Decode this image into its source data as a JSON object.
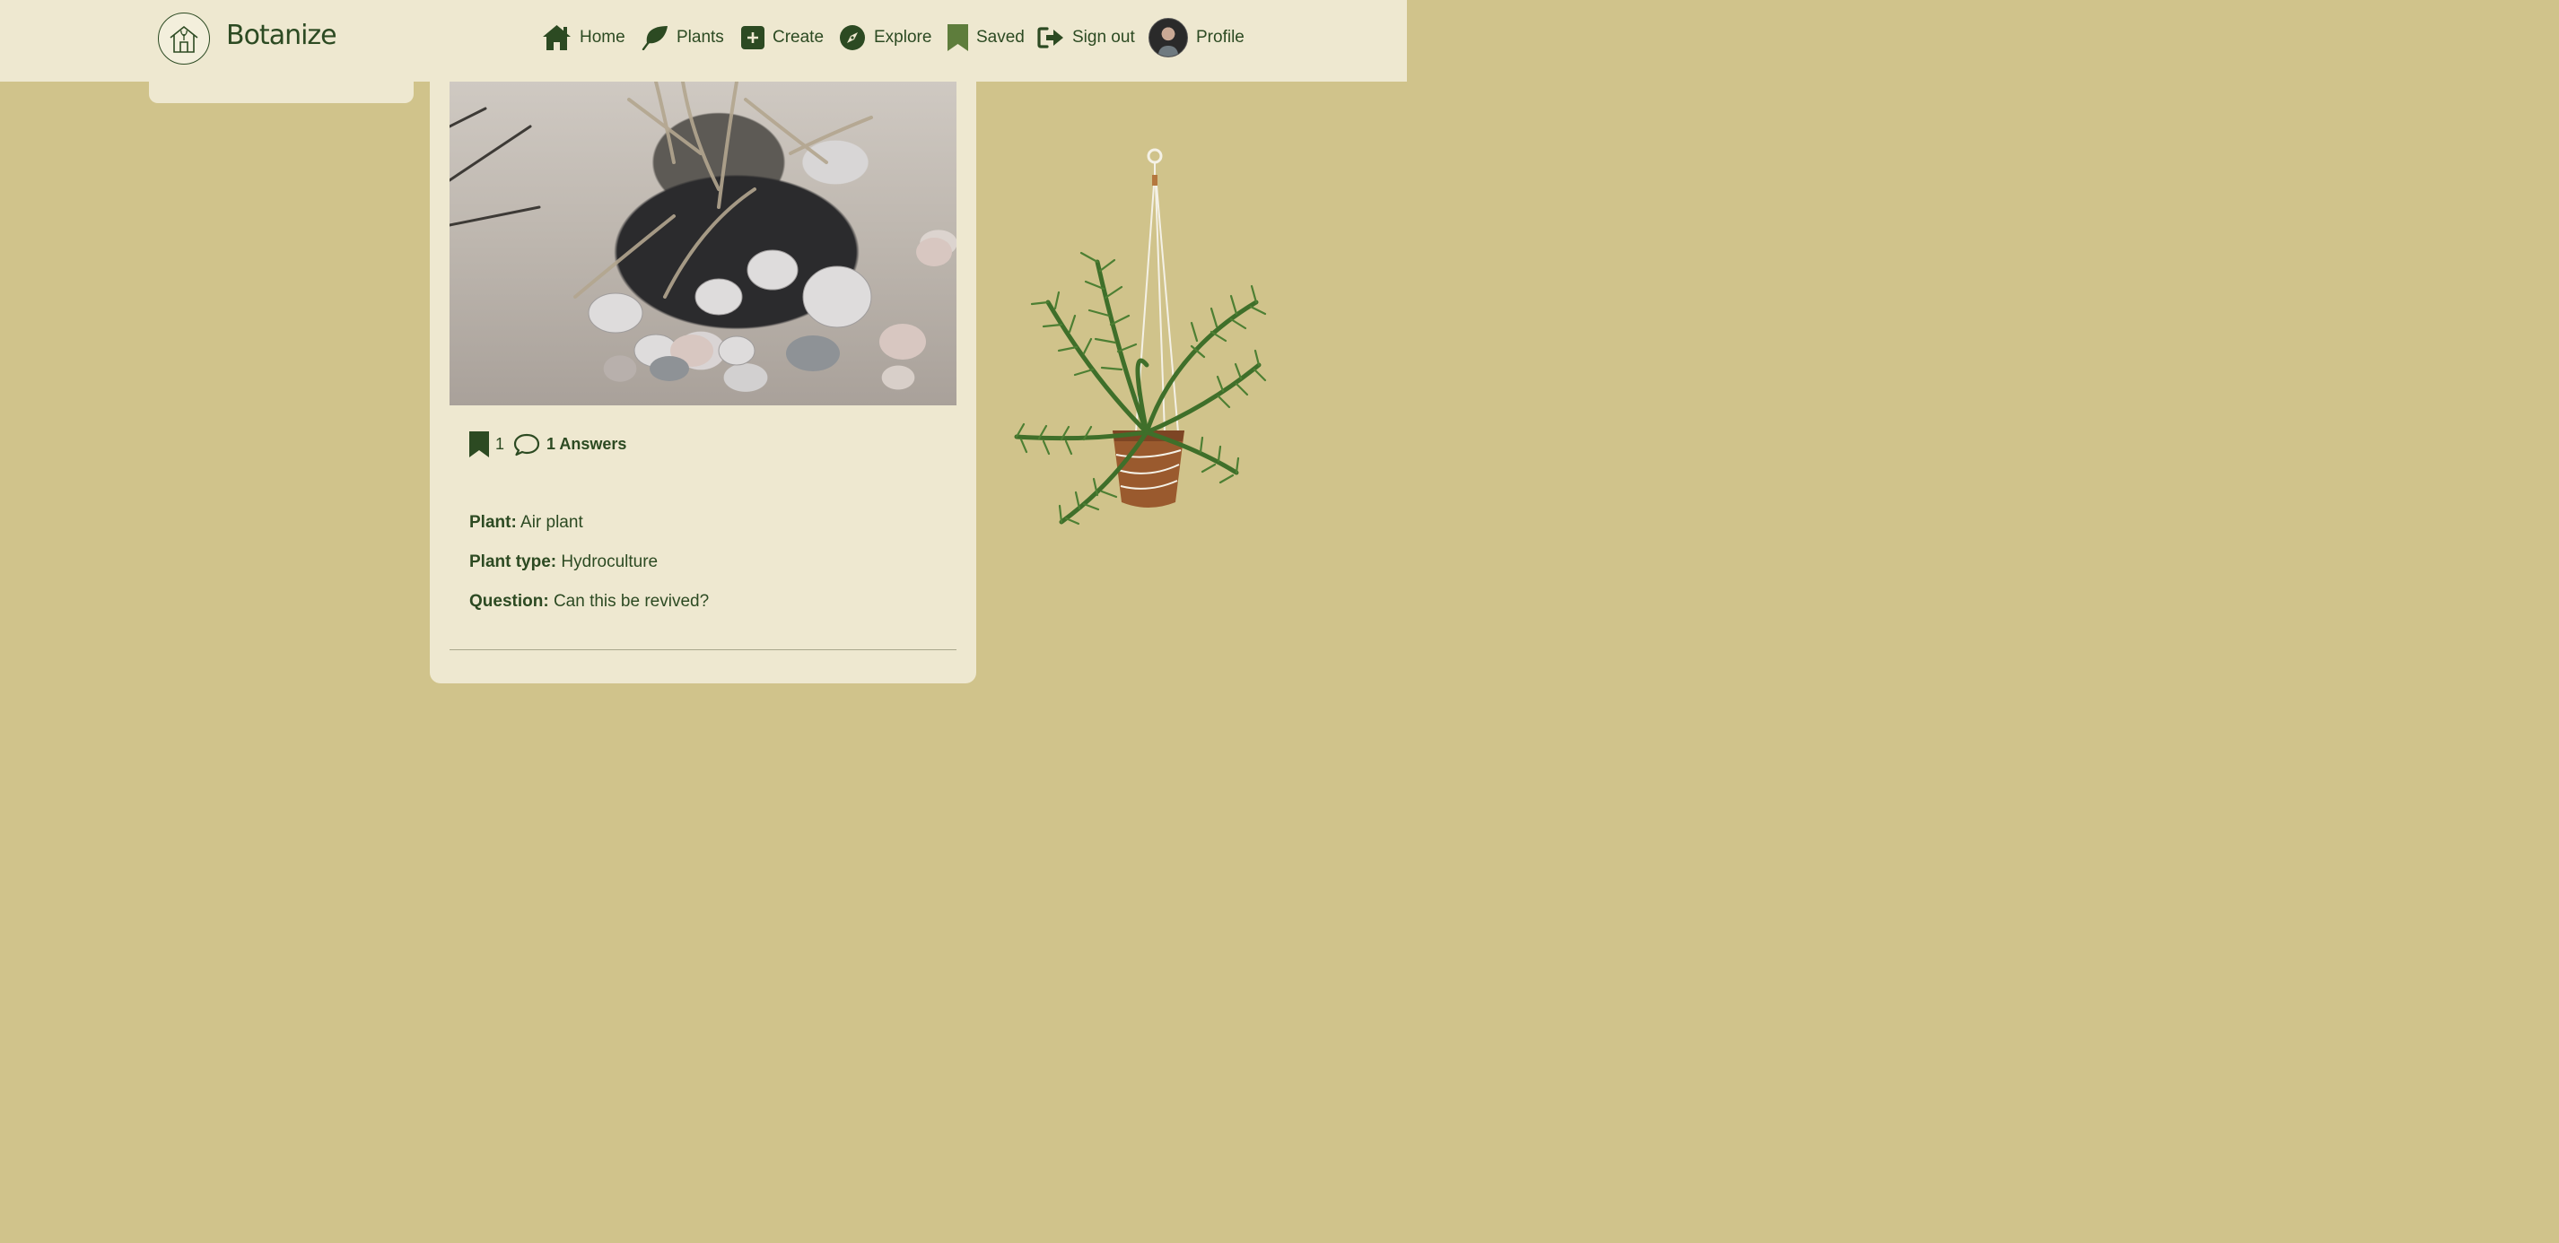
{
  "header": {
    "brand": "Botanize",
    "nav": [
      {
        "label": "Home",
        "icon": "home-icon"
      },
      {
        "label": "Plants",
        "icon": "leaf-icon"
      },
      {
        "label": "Create",
        "icon": "plus-square-icon"
      },
      {
        "label": "Explore",
        "icon": "compass-icon"
      },
      {
        "label": "Saved",
        "icon": "bookmark-icon"
      },
      {
        "label": "Sign out",
        "icon": "sign-out-icon"
      },
      {
        "label": "Profile",
        "icon": "avatar"
      }
    ]
  },
  "post": {
    "saves_count": "1",
    "answers_label": "1 Answers",
    "fields": [
      {
        "label": "Plant:",
        "value": "Air plant"
      },
      {
        "label": "Plant type:",
        "value": "Hydroculture"
      },
      {
        "label": "Question:",
        "value": "Can this be revived?"
      }
    ]
  },
  "colors": {
    "page_background": "#d0c38b",
    "surface": "#eee8d0",
    "primary_green": "#2c4a22",
    "saved_green": "#5e7d3c"
  }
}
